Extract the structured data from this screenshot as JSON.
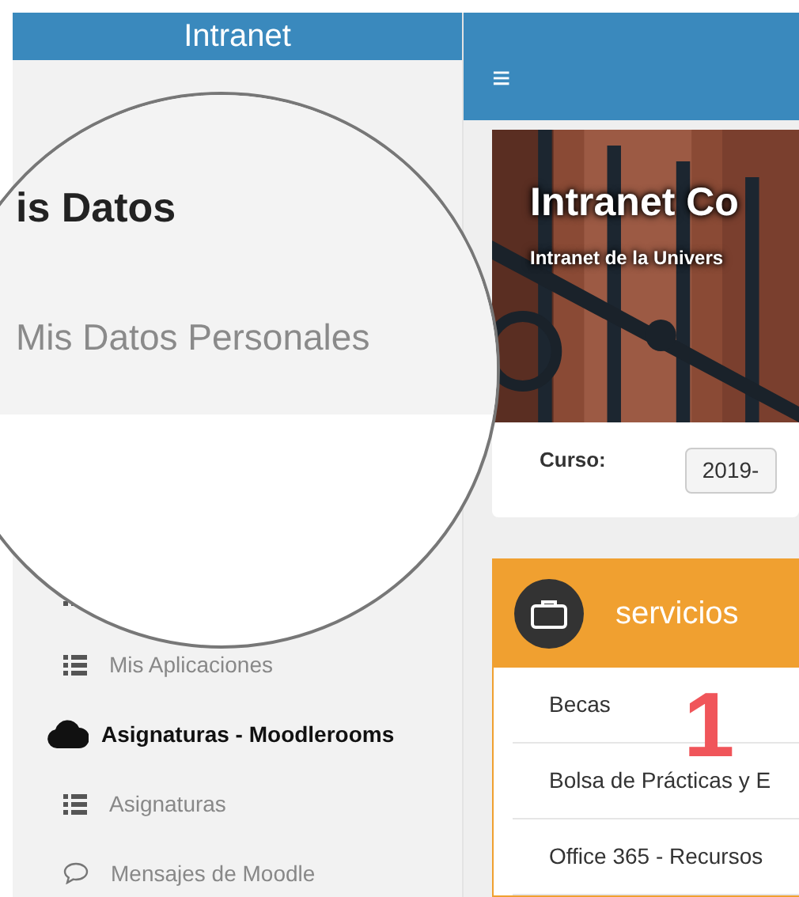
{
  "sidebar": {
    "title": "Intranet",
    "items": [
      {
        "kind": "link"
      },
      {
        "kind": "link",
        "label": "Mis Aplicaciones"
      },
      {
        "kind": "section",
        "label": "Asignaturas - Moodlerooms"
      },
      {
        "kind": "link",
        "label": "Asignaturas"
      },
      {
        "kind": "message",
        "label": "Mensajes de Moodle"
      }
    ]
  },
  "magnifier": {
    "heading": "is Datos",
    "item": "Mis Datos Personales"
  },
  "header": {
    "menu_glyph": "≡"
  },
  "banner": {
    "kind": "picture",
    "title": "Intranet Co",
    "subtitle": "Intranet de la Univers"
  },
  "course": {
    "label": "Curso:",
    "value": "2019-"
  },
  "services": {
    "title": "servicios",
    "items": [
      {
        "label": "Becas"
      },
      {
        "label": "Bolsa de Prácticas y E"
      },
      {
        "label": "Office 365 - Recursos"
      }
    ]
  },
  "annotation": {
    "text": "1"
  }
}
